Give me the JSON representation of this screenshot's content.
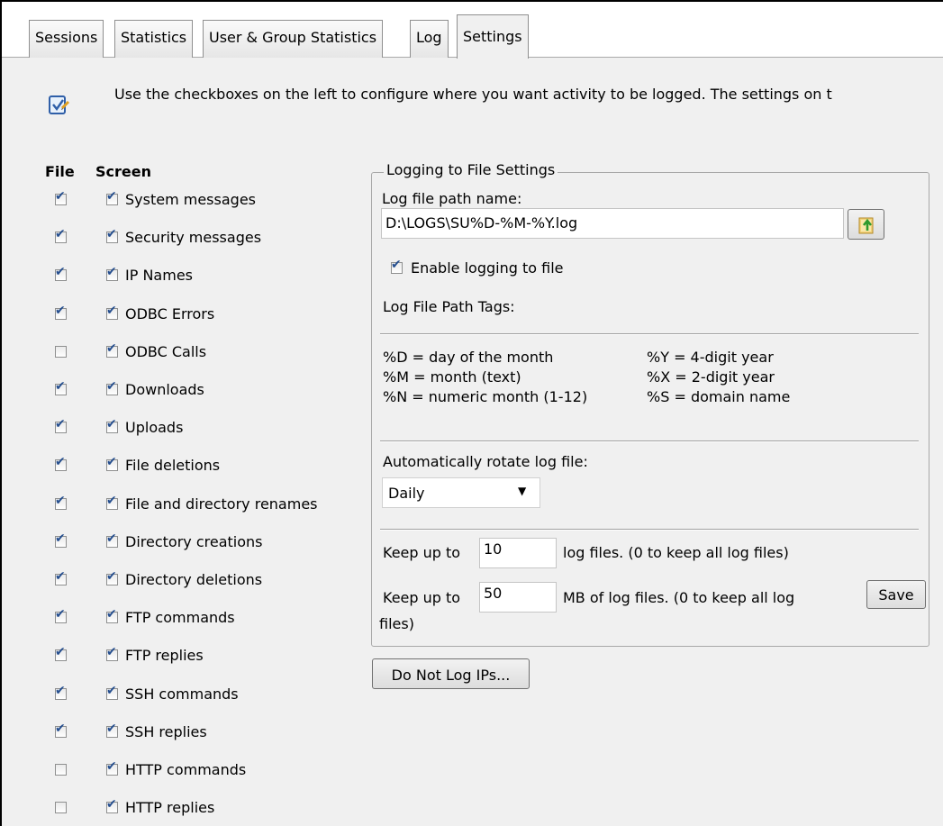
{
  "tabs": [
    {
      "label": "Sessions"
    },
    {
      "label": "Statistics"
    },
    {
      "label": "User & Group Statistics"
    },
    {
      "label": "Log"
    },
    {
      "label": "Settings"
    }
  ],
  "intro_text": "Use the checkboxes on the left to configure where you want activity to be logged. The settings on t",
  "columns": {
    "file": "File",
    "screen": "Screen"
  },
  "log_items": [
    {
      "label": "System messages",
      "file": true,
      "screen": true
    },
    {
      "label": "Security messages",
      "file": true,
      "screen": true
    },
    {
      "label": "IP Names",
      "file": true,
      "screen": true
    },
    {
      "label": "ODBC Errors",
      "file": true,
      "screen": true
    },
    {
      "label": "ODBC Calls",
      "file": false,
      "screen": true
    },
    {
      "label": "Downloads",
      "file": true,
      "screen": true
    },
    {
      "label": "Uploads",
      "file": true,
      "screen": true
    },
    {
      "label": "File deletions",
      "file": true,
      "screen": true
    },
    {
      "label": "File and directory renames",
      "file": true,
      "screen": true
    },
    {
      "label": "Directory creations",
      "file": true,
      "screen": true
    },
    {
      "label": "Directory deletions",
      "file": true,
      "screen": true
    },
    {
      "label": "FTP commands",
      "file": true,
      "screen": true
    },
    {
      "label": "FTP replies",
      "file": true,
      "screen": true
    },
    {
      "label": "SSH commands",
      "file": true,
      "screen": true
    },
    {
      "label": "SSH replies",
      "file": true,
      "screen": true
    },
    {
      "label": "HTTP commands",
      "file": false,
      "screen": true
    },
    {
      "label": "HTTP replies",
      "file": false,
      "screen": true
    }
  ],
  "file_settings": {
    "legend": "Logging to File Settings",
    "path_label": "Log file path name:",
    "path_value": "D:\\LOGS\\SU%D-%M-%Y.log",
    "enable_label": "Enable logging to file",
    "enable_checked": true,
    "tags_title": "Log File Path Tags:",
    "tags_left": [
      "%D = day of the month",
      "%M = month (text)",
      "%N = numeric month (1-12)"
    ],
    "tags_right": [
      "%Y = 4-digit year",
      "%X = 2-digit year",
      "%S = domain name"
    ],
    "rotate_label": "Automatically rotate log file:",
    "rotate_value": "Daily",
    "keep_prefix": "Keep up to",
    "keep_files_value": "10",
    "keep_files_suffix": "log files. (0 to keep all log files)",
    "keep_mb_value": "50",
    "keep_mb_suffix": "MB of log files. (0 to keep all log",
    "keep_mb_suffix2": "files)",
    "save_label": "Save"
  },
  "do_not_log_label": "Do Not Log IPs...",
  "colors": {
    "panel": "#f0f0f0",
    "check": "#264f8f"
  }
}
